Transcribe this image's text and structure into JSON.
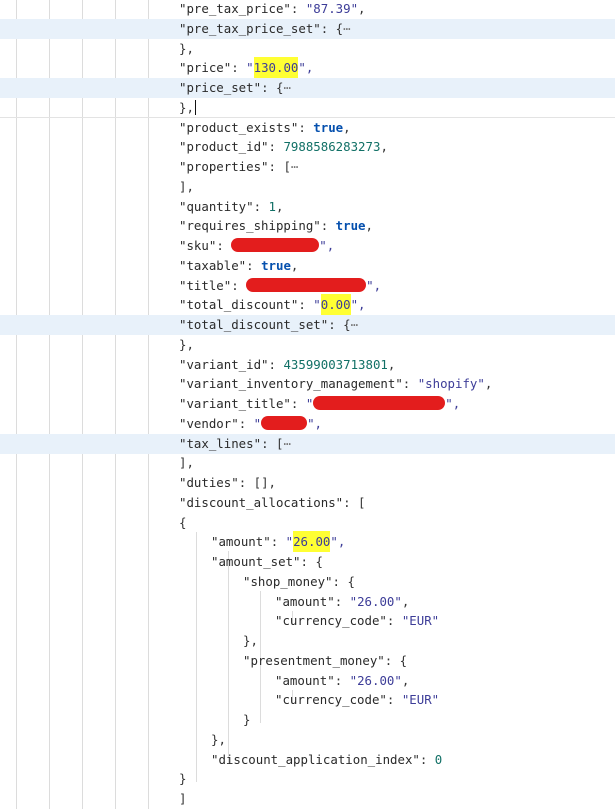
{
  "lines": [
    {
      "indent": 0,
      "tokens": [
        {
          "t": "\"pre_tax_price\"",
          "c": "k"
        },
        {
          "t": ": ",
          "c": "p"
        },
        {
          "t": "\"87.39\"",
          "c": "sv"
        },
        {
          "t": ",",
          "c": "p"
        }
      ]
    },
    {
      "indent": 0,
      "alt": true,
      "tokens": [
        {
          "t": "\"pre_tax_price_set\"",
          "c": "k"
        },
        {
          "t": ": {",
          "c": "p"
        },
        {
          "t": "⋯",
          "c": "ell"
        }
      ]
    },
    {
      "indent": 0,
      "tokens": [
        {
          "t": "},",
          "c": "p"
        }
      ]
    },
    {
      "indent": 0,
      "tokens": [
        {
          "t": "\"price\"",
          "c": "k"
        },
        {
          "t": ": ",
          "c": "p"
        },
        {
          "t": "\"",
          "c": "sv"
        },
        {
          "t": "130.00",
          "c": "sv",
          "hl": true
        },
        {
          "t": "\",",
          "c": "sv"
        }
      ]
    },
    {
      "indent": 0,
      "alt": true,
      "tokens": [
        {
          "t": "\"price_set\"",
          "c": "k"
        },
        {
          "t": ": {",
          "c": "p"
        },
        {
          "t": "⋯",
          "c": "ell"
        }
      ]
    },
    {
      "indent": 0,
      "sep": true,
      "tokens": [
        {
          "t": "},",
          "c": "p"
        },
        {
          "cursor": true
        }
      ]
    },
    {
      "indent": 0,
      "tokens": [
        {
          "t": "\"product_exists\"",
          "c": "k"
        },
        {
          "t": ": ",
          "c": "p"
        },
        {
          "t": "true",
          "c": "bool"
        },
        {
          "t": ",",
          "c": "p"
        }
      ]
    },
    {
      "indent": 0,
      "tokens": [
        {
          "t": "\"product_id\"",
          "c": "k"
        },
        {
          "t": ": ",
          "c": "p"
        },
        {
          "t": "7988586283273",
          "c": "num"
        },
        {
          "t": ",",
          "c": "p"
        }
      ]
    },
    {
      "indent": 0,
      "tokens": [
        {
          "t": "\"properties\"",
          "c": "k"
        },
        {
          "t": ": [",
          "c": "p"
        },
        {
          "t": "⋯",
          "c": "ell"
        }
      ]
    },
    {
      "indent": 0,
      "tokens": [
        {
          "t": "],",
          "c": "p"
        }
      ]
    },
    {
      "indent": 0,
      "tokens": [
        {
          "t": "\"quantity\"",
          "c": "k"
        },
        {
          "t": ": ",
          "c": "p"
        },
        {
          "t": "1",
          "c": "num"
        },
        {
          "t": ",",
          "c": "p"
        }
      ]
    },
    {
      "indent": 0,
      "tokens": [
        {
          "t": "\"requires_shipping\"",
          "c": "k"
        },
        {
          "t": ": ",
          "c": "p"
        },
        {
          "t": "true",
          "c": "bool"
        },
        {
          "t": ",",
          "c": "p"
        }
      ]
    },
    {
      "indent": 0,
      "tokens": [
        {
          "t": "\"sku\"",
          "c": "k"
        },
        {
          "t": ": ",
          "c": "p"
        },
        {
          "redact": 88
        },
        {
          "t": "\",",
          "c": "sv"
        }
      ]
    },
    {
      "indent": 0,
      "tokens": [
        {
          "t": "\"taxable\"",
          "c": "k"
        },
        {
          "t": ": ",
          "c": "p"
        },
        {
          "t": "true",
          "c": "bool"
        },
        {
          "t": ",",
          "c": "p"
        }
      ]
    },
    {
      "indent": 0,
      "tokens": [
        {
          "t": "\"title\"",
          "c": "k"
        },
        {
          "t": ": ",
          "c": "p"
        },
        {
          "redact": 120
        },
        {
          "t": "\",",
          "c": "sv"
        }
      ]
    },
    {
      "indent": 0,
      "tokens": [
        {
          "t": "\"total_discount\"",
          "c": "k"
        },
        {
          "t": ": ",
          "c": "p"
        },
        {
          "t": "\"",
          "c": "sv"
        },
        {
          "t": "0.00",
          "c": "sv",
          "hl": true
        },
        {
          "t": "\",",
          "c": "sv"
        }
      ]
    },
    {
      "indent": 0,
      "alt": true,
      "tokens": [
        {
          "t": "\"total_discount_set\"",
          "c": "k"
        },
        {
          "t": ": {",
          "c": "p"
        },
        {
          "t": "⋯",
          "c": "ell"
        }
      ]
    },
    {
      "indent": 0,
      "tokens": [
        {
          "t": "},",
          "c": "p"
        }
      ]
    },
    {
      "indent": 0,
      "tokens": [
        {
          "t": "\"variant_id\"",
          "c": "k"
        },
        {
          "t": ": ",
          "c": "p"
        },
        {
          "t": "43599003713801",
          "c": "num"
        },
        {
          "t": ",",
          "c": "p"
        }
      ]
    },
    {
      "indent": 0,
      "tokens": [
        {
          "t": "\"variant_inventory_management\"",
          "c": "k"
        },
        {
          "t": ": ",
          "c": "p"
        },
        {
          "t": "\"shopify\"",
          "c": "sv"
        },
        {
          "t": ",",
          "c": "p"
        }
      ]
    },
    {
      "indent": 0,
      "tokens": [
        {
          "t": "\"variant_title\"",
          "c": "k"
        },
        {
          "t": ": ",
          "c": "p"
        },
        {
          "t": "\"",
          "c": "sv"
        },
        {
          "redact": 132
        },
        {
          "t": "\",",
          "c": "sv"
        }
      ]
    },
    {
      "indent": 0,
      "tokens": [
        {
          "t": "\"vendor\"",
          "c": "k"
        },
        {
          "t": ": ",
          "c": "p"
        },
        {
          "t": "\"",
          "c": "sv"
        },
        {
          "redact": 46
        },
        {
          "t": "\",",
          "c": "sv"
        }
      ]
    },
    {
      "indent": 0,
      "alt": true,
      "tokens": [
        {
          "t": "\"tax_lines\"",
          "c": "k"
        },
        {
          "t": ": [",
          "c": "p"
        },
        {
          "t": "⋯",
          "c": "ell"
        }
      ]
    },
    {
      "indent": 0,
      "tokens": [
        {
          "t": "],",
          "c": "p"
        }
      ]
    },
    {
      "indent": -1,
      "tokens": [
        {
          "t": "\"duties\"",
          "c": "k"
        },
        {
          "t": ": [],",
          "c": "p"
        }
      ]
    },
    {
      "indent": -1,
      "tokens": [
        {
          "t": "\"discount_allocations\"",
          "c": "k"
        },
        {
          "t": ": [",
          "c": "p"
        }
      ]
    },
    {
      "indent": 0,
      "tokens": [
        {
          "t": "{",
          "c": "p"
        }
      ]
    },
    {
      "indent": 1,
      "tokens": [
        {
          "t": "\"amount\"",
          "c": "k"
        },
        {
          "t": ": ",
          "c": "p"
        },
        {
          "t": "\"",
          "c": "sv"
        },
        {
          "t": "26.00",
          "c": "sv",
          "hl": true
        },
        {
          "t": "\",",
          "c": "sv"
        }
      ]
    },
    {
      "indent": 1,
      "tokens": [
        {
          "t": "\"amount_set\"",
          "c": "k"
        },
        {
          "t": ": {",
          "c": "p"
        }
      ]
    },
    {
      "indent": 2,
      "tokens": [
        {
          "t": "\"shop_money\"",
          "c": "k"
        },
        {
          "t": ": {",
          "c": "p"
        }
      ]
    },
    {
      "indent": 3,
      "tokens": [
        {
          "t": "\"amount\"",
          "c": "k"
        },
        {
          "t": ": ",
          "c": "p"
        },
        {
          "t": "\"26.00\"",
          "c": "sv"
        },
        {
          "t": ",",
          "c": "p"
        }
      ]
    },
    {
      "indent": 3,
      "tokens": [
        {
          "t": "\"currency_code\"",
          "c": "k"
        },
        {
          "t": ": ",
          "c": "p"
        },
        {
          "t": "\"EUR\"",
          "c": "sv"
        }
      ]
    },
    {
      "indent": 2,
      "tokens": [
        {
          "t": "},",
          "c": "p"
        }
      ]
    },
    {
      "indent": 2,
      "tokens": [
        {
          "t": "\"presentment_money\"",
          "c": "k"
        },
        {
          "t": ": {",
          "c": "p"
        }
      ]
    },
    {
      "indent": 3,
      "tokens": [
        {
          "t": "\"amount\"",
          "c": "k"
        },
        {
          "t": ": ",
          "c": "p"
        },
        {
          "t": "\"26.00\"",
          "c": "sv"
        },
        {
          "t": ",",
          "c": "p"
        }
      ]
    },
    {
      "indent": 3,
      "tokens": [
        {
          "t": "\"currency_code\"",
          "c": "k"
        },
        {
          "t": ": ",
          "c": "p"
        },
        {
          "t": "\"EUR\"",
          "c": "sv"
        }
      ]
    },
    {
      "indent": 2,
      "tokens": [
        {
          "t": "}",
          "c": "p"
        }
      ]
    },
    {
      "indent": 1,
      "tokens": [
        {
          "t": "},",
          "c": "p"
        }
      ]
    },
    {
      "indent": 1,
      "tokens": [
        {
          "t": "\"discount_application_index\"",
          "c": "k"
        },
        {
          "t": ": ",
          "c": "p"
        },
        {
          "t": "0",
          "c": "num"
        }
      ]
    },
    {
      "indent": 0,
      "tokens": [
        {
          "t": "}",
          "c": "p"
        }
      ]
    },
    {
      "indent": -1,
      "tokens": [
        {
          "t": "]",
          "c": "p"
        }
      ]
    }
  ],
  "colors": {
    "row_highlight": "#e8f1fa",
    "string_value": "#3d3d98",
    "number_value": "#117066",
    "boolean_value": "#0550ae",
    "search_match": "#ffff33",
    "redaction": "#e31d1d"
  }
}
